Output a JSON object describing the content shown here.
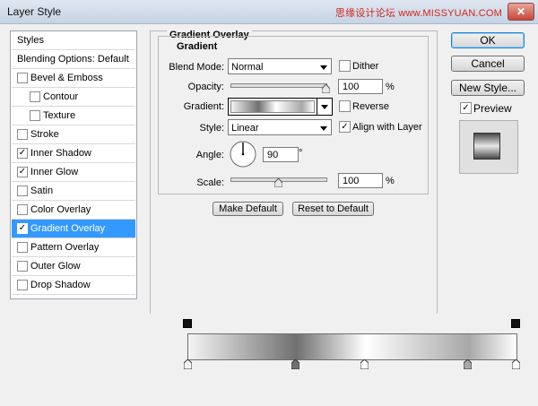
{
  "window": {
    "title": "Layer Style",
    "watermark": "思缘设计论坛 www.MISSYUAN.COM",
    "close": "✕"
  },
  "styles_list": {
    "header": "Styles",
    "blending": "Blending Options: Default",
    "items": [
      {
        "label": "Bevel & Emboss",
        "checked": false,
        "indent": false
      },
      {
        "label": "Contour",
        "checked": false,
        "indent": true
      },
      {
        "label": "Texture",
        "checked": false,
        "indent": true
      },
      {
        "label": "Stroke",
        "checked": false,
        "indent": false
      },
      {
        "label": "Inner Shadow",
        "checked": true,
        "indent": false
      },
      {
        "label": "Inner Glow",
        "checked": true,
        "indent": false
      },
      {
        "label": "Satin",
        "checked": false,
        "indent": false
      },
      {
        "label": "Color Overlay",
        "checked": false,
        "indent": false
      },
      {
        "label": "Gradient Overlay",
        "checked": true,
        "indent": false,
        "selected": true
      },
      {
        "label": "Pattern Overlay",
        "checked": false,
        "indent": false
      },
      {
        "label": "Outer Glow",
        "checked": false,
        "indent": false
      },
      {
        "label": "Drop Shadow",
        "checked": false,
        "indent": false
      }
    ]
  },
  "gradient_overlay": {
    "section_title": "Gradient Overlay",
    "group_title": "Gradient",
    "blend_mode_label": "Blend Mode:",
    "blend_mode_value": "Normal",
    "dither_label": "Dither",
    "dither_checked": false,
    "opacity_label": "Opacity:",
    "opacity_value": "100",
    "opacity_unit": "%",
    "opacity_level": 1.0,
    "gradient_label": "Gradient:",
    "reverse_label": "Reverse",
    "reverse_checked": false,
    "style_label": "Style:",
    "style_value": "Linear",
    "align_label": "Align with Layer",
    "align_checked": true,
    "angle_label": "Angle:",
    "angle_value": "90",
    "angle_unit": "°",
    "scale_label": "Scale:",
    "scale_value": "100",
    "scale_unit": "%",
    "scale_level": 0.5,
    "make_default": "Make Default",
    "reset_default": "Reset to Default"
  },
  "buttons": {
    "ok": "OK",
    "cancel": "Cancel",
    "new_style": "New Style...",
    "preview_label": "Preview",
    "preview_checked": true
  },
  "gradient_editor": {
    "colors": [
      "#f4f4f4",
      "#707070",
      "#ffffff",
      "#a8a8a8",
      "#ffffff"
    ],
    "color_stop_positions": [
      0,
      0.33,
      0.54,
      0.855,
      1.0
    ],
    "opacity_stop_positions": [
      0,
      1.0
    ]
  },
  "check_glyph": "✓"
}
